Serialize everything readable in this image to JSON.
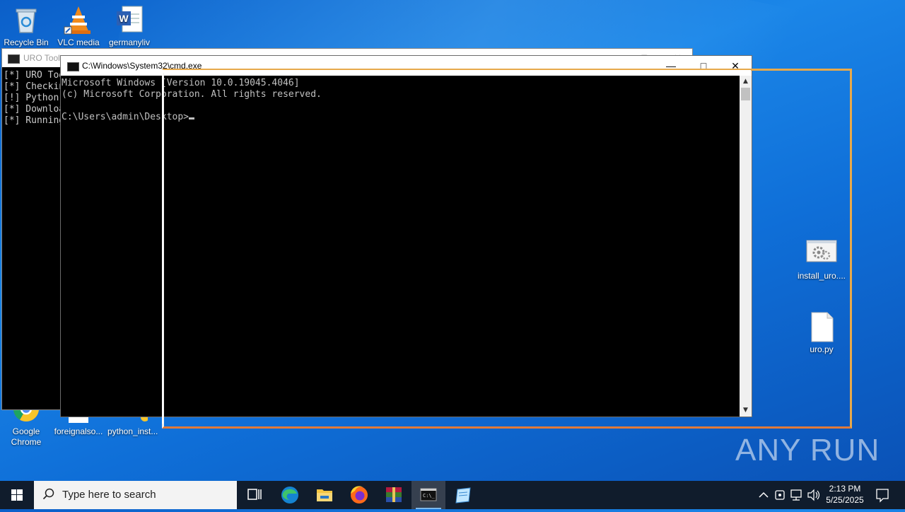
{
  "desktop": {
    "icons": [
      {
        "label": "Recycle Bin",
        "icon": "recycle-bin-icon"
      },
      {
        "label": "VLC media",
        "icon": "vlc-icon"
      },
      {
        "label": "germanyliv",
        "icon": "word-doc-icon"
      },
      {
        "label": "Google Chrome",
        "icon": "chrome-icon"
      },
      {
        "label": "foreignalso...",
        "icon": "file-icon"
      },
      {
        "label": "python_inst...",
        "icon": "python-installer-icon"
      },
      {
        "label": "install_uro....",
        "icon": "batch-file-icon"
      },
      {
        "label": "uro.py",
        "icon": "file-icon"
      }
    ]
  },
  "uro_window": {
    "title": "URO Tool",
    "lines": [
      "[*] URO Too",
      "[*] Checkin",
      "[!] Python",
      "[*] Downloa",
      "[*] Running"
    ]
  },
  "cmd_window": {
    "title": "C:\\Windows\\System32\\cmd.exe",
    "lines": [
      "Microsoft Windows [Version 10.0.19045.4046]",
      "(c) Microsoft Corporation. All rights reserved.",
      "",
      "C:\\Users\\admin\\Desktop>"
    ]
  },
  "watermark": "ANY RUN",
  "taskbar": {
    "search_placeholder": "Type here to search",
    "time": "2:13 PM",
    "date": "5/25/2025",
    "apps": [
      "task-view",
      "edge",
      "file-explorer",
      "firefox",
      "winrar",
      "cmd",
      "notepad"
    ]
  },
  "colors": {
    "desktop": "#1478dc",
    "taskbar": "#101c2c",
    "highlight": "#e7a94b"
  }
}
